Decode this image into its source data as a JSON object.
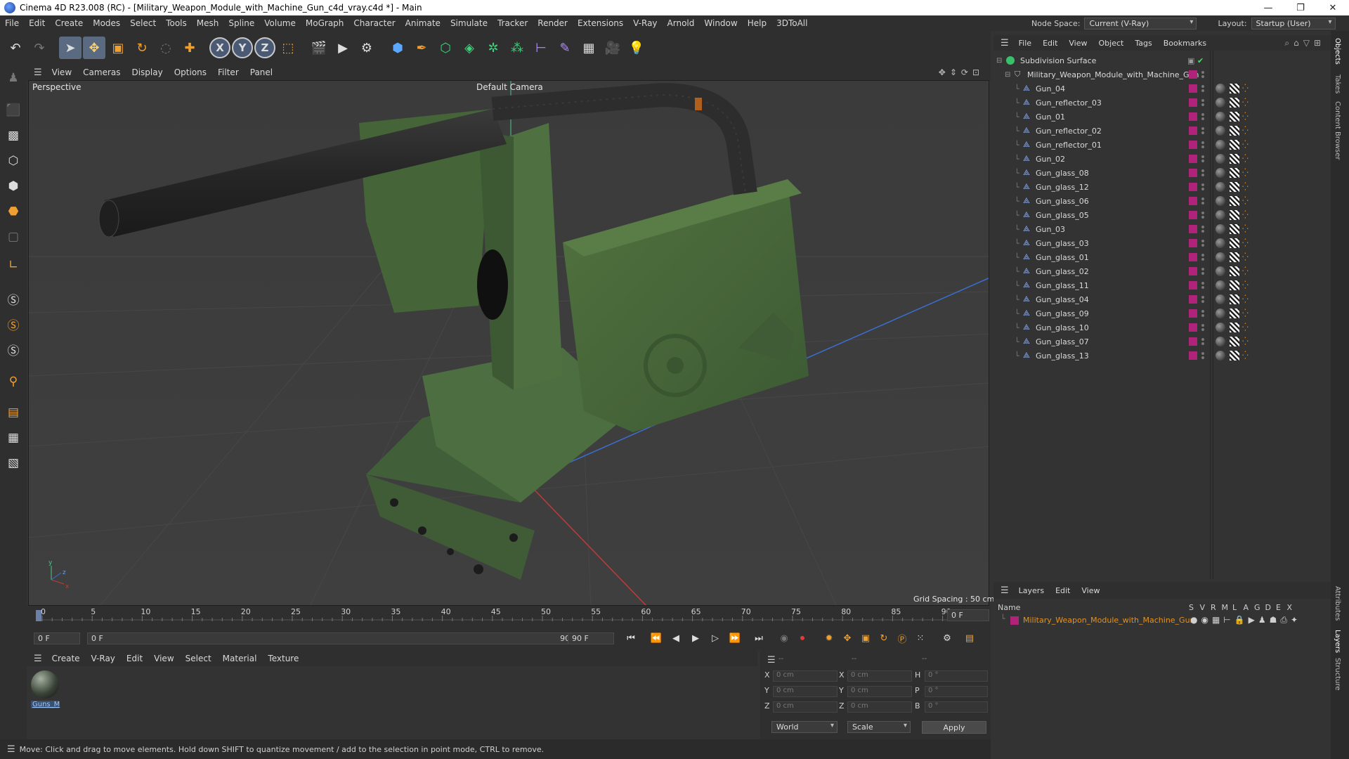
{
  "window": {
    "title": "Cinema 4D R23.008 (RC) - [Military_Weapon_Module_with_Machine_Gun_c4d_vray.c4d *] - Main",
    "controls": [
      "—",
      "❐",
      "✕"
    ]
  },
  "menubar": {
    "items": [
      "File",
      "Edit",
      "Create",
      "Modes",
      "Select",
      "Tools",
      "Mesh",
      "Spline",
      "Volume",
      "MoGraph",
      "Character",
      "Animate",
      "Simulate",
      "Tracker",
      "Render",
      "Extensions",
      "V-Ray",
      "Arnold",
      "Window",
      "Help",
      "3DToAll"
    ],
    "node_space_label": "Node Space:",
    "node_space_value": "Current (V-Ray)",
    "layout_label": "Layout:",
    "layout_value": "Startup (User)"
  },
  "viewport": {
    "menu": [
      "View",
      "Cameras",
      "Display",
      "Options",
      "Filter",
      "Panel"
    ],
    "label": "Perspective",
    "camera": "Default Camera",
    "grid_spacing": "Grid Spacing : 50 cm"
  },
  "timeline": {
    "ticks": [
      "0",
      "5",
      "10",
      "15",
      "20",
      "25",
      "30",
      "35",
      "40",
      "45",
      "50",
      "55",
      "60",
      "65",
      "70",
      "75",
      "80",
      "85",
      "90"
    ],
    "current_frame": "0 F",
    "start_field": "0 F",
    "range_start": "0 F",
    "range_end": "90 F",
    "end_field": "90 F"
  },
  "material_manager": {
    "menu": [
      "Create",
      "V-Ray",
      "Edit",
      "View",
      "Select",
      "Material",
      "Texture"
    ],
    "materials": [
      {
        "label": "Guns_M"
      }
    ]
  },
  "coordinates": {
    "header": [
      "--",
      "--",
      "--"
    ],
    "rows": [
      {
        "a": "X",
        "av": "0 cm",
        "b": "X",
        "bv": "0 cm",
        "c": "H",
        "cv": "0 °"
      },
      {
        "a": "Y",
        "av": "0 cm",
        "b": "Y",
        "bv": "0 cm",
        "c": "P",
        "cv": "0 °"
      },
      {
        "a": "Z",
        "av": "0 cm",
        "b": "Z",
        "bv": "0 cm",
        "c": "B",
        "cv": "0 °"
      }
    ],
    "mode": "World",
    "transform": "Scale",
    "apply": "Apply"
  },
  "status": {
    "text": "Move: Click and drag to move elements. Hold down SHIFT to quantize movement / add to the selection in point mode, CTRL to remove."
  },
  "object_manager": {
    "menu": [
      "File",
      "Edit",
      "View",
      "Object",
      "Tags",
      "Bookmarks"
    ],
    "root": "Subdivision Surface",
    "group": "Military_Weapon_Module_with_Machine_Gun",
    "objects": [
      "Gun_04",
      "Gun_reflector_03",
      "Gun_01",
      "Gun_reflector_02",
      "Gun_reflector_01",
      "Gun_02",
      "Gun_glass_08",
      "Gun_glass_12",
      "Gun_glass_06",
      "Gun_glass_05",
      "Gun_03",
      "Gun_glass_03",
      "Gun_glass_01",
      "Gun_glass_02",
      "Gun_glass_11",
      "Gun_glass_04",
      "Gun_glass_09",
      "Gun_glass_10",
      "Gun_glass_07",
      "Gun_glass_13"
    ]
  },
  "layer_manager": {
    "menu": [
      "Layers",
      "Edit",
      "View"
    ],
    "columns": [
      "S",
      "V",
      "R",
      "M",
      "L",
      "A",
      "G",
      "D",
      "E",
      "X"
    ],
    "name_header": "Name",
    "layers": [
      {
        "name": "Military_Weapon_Module_with_Machine_Gun"
      }
    ]
  },
  "right_tabs": [
    "Objects",
    "Takes",
    "Content Browser",
    "Attributes",
    "Layers",
    "Structure"
  ],
  "colors": {
    "layer": "#b0237a",
    "model_green": "#4b6d3f",
    "highlight_orange": "#e6921c"
  }
}
